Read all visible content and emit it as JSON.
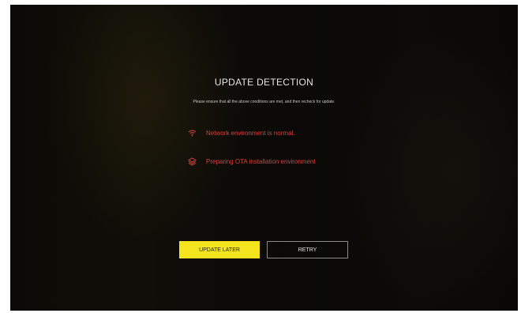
{
  "dialog": {
    "title": "UPDATE DETECTION",
    "subtitle": "Please ensure that all the above conditions are met, and then recheck for update."
  },
  "conditions": [
    {
      "icon": "wifi-icon",
      "text": "Network environment is normal."
    },
    {
      "icon": "layers-icon",
      "text": "Preparing OTA installation environment"
    }
  ],
  "buttons": {
    "update_later": "UPDATE LATER",
    "retry": "RETRY"
  },
  "colors": {
    "background": "#0b0a06",
    "condition_text": "#d2443f",
    "primary_button": "#f3e41d",
    "secondary_border": "#8a8a8a"
  }
}
